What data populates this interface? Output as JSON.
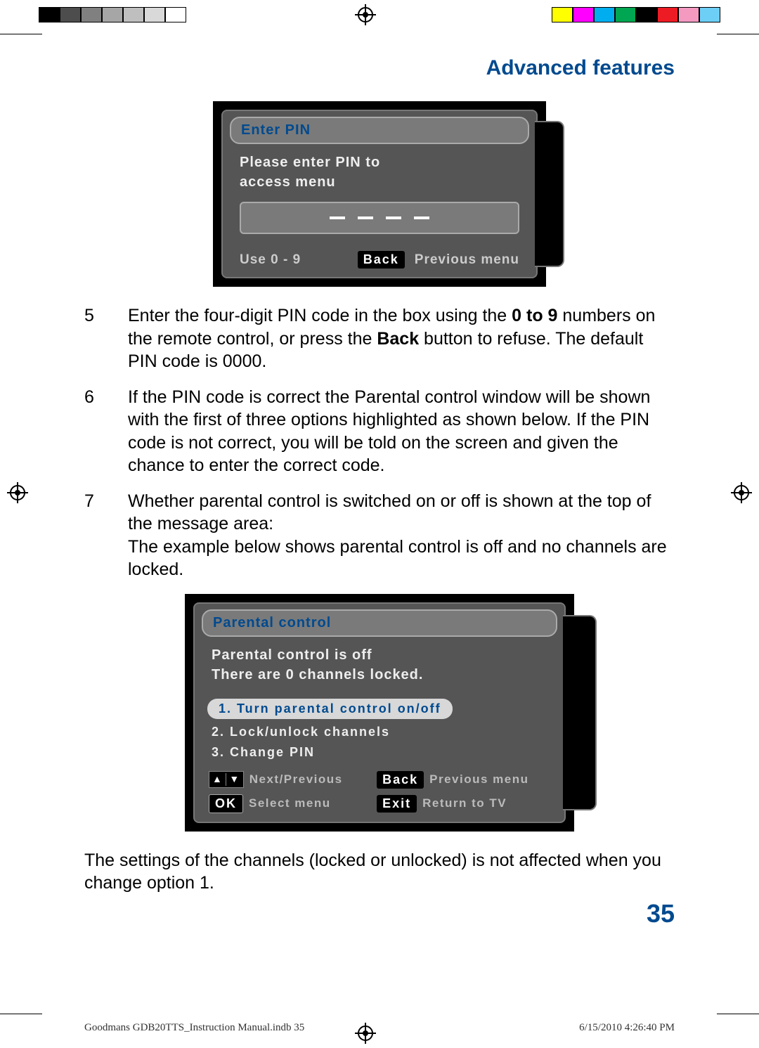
{
  "header": {
    "section_title": "Advanced features"
  },
  "osd1": {
    "title": "Enter PIN",
    "prompt_l1": "Please enter PIN to",
    "prompt_l2": "access menu",
    "hint_use": "Use 0 - 9",
    "hint_back_key": "Back",
    "hint_back_label": "Previous menu"
  },
  "steps": {
    "s5": {
      "n": "5",
      "pre": "Enter the four-digit PIN code in the box using the ",
      "bold1": "0 to 9",
      "mid": " numbers on the remote control, or press the ",
      "bold2": "Back",
      "post": " button to refuse. The default PIN code is 0000."
    },
    "s6": {
      "n": "6",
      "text": "If the PIN code is correct the Parental control window will be shown with the first of three options highlighted as shown below. If the PIN code is not correct, you will be told on the screen and given the chance to enter the correct code."
    },
    "s7": {
      "n": "7",
      "l1": "Whether parental control is switched on or off is shown at the top of the message area:",
      "l2": "The example below shows parental control is off and no channels are locked."
    }
  },
  "osd2": {
    "title": "Parental control",
    "status_l1": "Parental control is off",
    "status_l2": "There are 0 channels locked.",
    "opt1": "1. Turn parental control on/off",
    "opt2": "2. Lock/unlock channels",
    "opt3": "3. Change PIN",
    "hk_nav_label": "Next/Previous",
    "hk_back_key": "Back",
    "hk_back_label": "Previous menu",
    "hk_ok_key": "OK",
    "hk_ok_label": "Select menu",
    "hk_exit_key": "Exit",
    "hk_exit_label": "Return to TV"
  },
  "closing": "The settings of the channels (locked or unlocked) is not affected when you change option 1.",
  "page_number": "35",
  "footer": {
    "left": "Goodmans GDB20TTS_Instruction Manual.indb   35",
    "right": "6/15/2010   4:26:40 PM"
  },
  "colorbars": {
    "left": [
      "#000000",
      "#4d4d4d",
      "#808080",
      "#a6a6a6",
      "#bfbfbf",
      "#d9d9d9",
      "#ffffff"
    ],
    "right": [
      "#ffff00",
      "#ff00ff",
      "#00aeef",
      "#00a651",
      "#000000",
      "#ed1c24",
      "#f49ac1",
      "#6dcff6"
    ]
  }
}
